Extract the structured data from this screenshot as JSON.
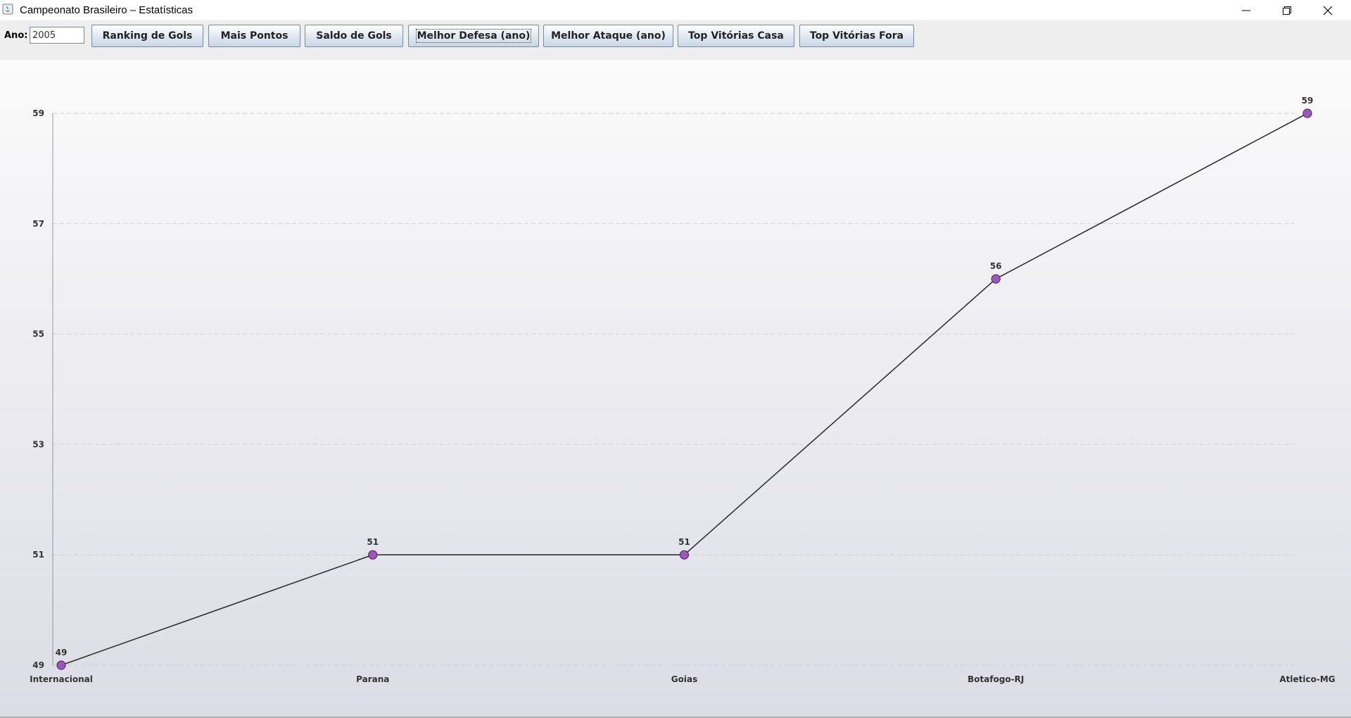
{
  "window": {
    "title": "Campeonato Brasileiro – Estatísticas",
    "controls": [
      "minimize-icon",
      "restore-icon",
      "close-icon"
    ]
  },
  "toolbar": {
    "year_label": "Ano:",
    "year_value": "2005",
    "buttons": [
      {
        "label": "Ranking de Gols"
      },
      {
        "label": "Mais Pontos"
      },
      {
        "label": "Saldo de Gols"
      },
      {
        "label": "Melhor Defesa (ano)"
      },
      {
        "label": "Melhor Ataque (ano)"
      },
      {
        "label": "Top Vitórias Casa"
      },
      {
        "label": "Top Vitórias Fora"
      }
    ],
    "focused_button": "Melhor Defesa (ano)"
  },
  "colors": {
    "line": "#333333",
    "point_fill": "#9b59b6",
    "point_stroke": "#5b2a73",
    "grid": "#d0d0d6",
    "axis": "#999999"
  },
  "chart_data": {
    "type": "line",
    "title": "",
    "xlabel": "",
    "ylabel": "",
    "categories": [
      "Internacional",
      "Parana",
      "Goias",
      "Botafogo-RJ",
      "Atletico-MG"
    ],
    "values": [
      49,
      51,
      51,
      56,
      59
    ],
    "y_ticks": [
      "49",
      "51",
      "53",
      "55",
      "57",
      "59"
    ],
    "ylim": [
      49,
      59
    ],
    "grid": true,
    "grid_style": "dashed",
    "legend": "none",
    "data_labels": [
      "49",
      "51",
      "51",
      "56",
      "59"
    ]
  }
}
